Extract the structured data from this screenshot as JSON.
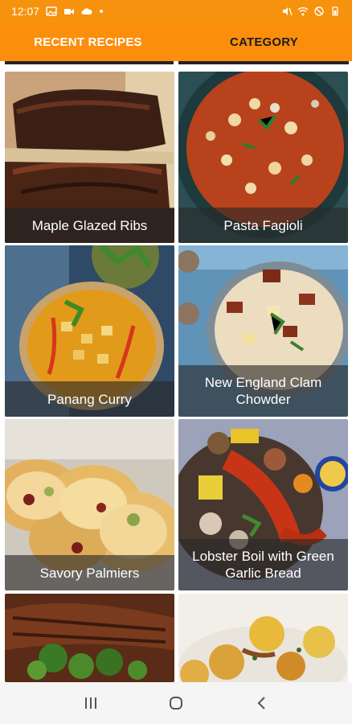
{
  "status_bar": {
    "time": "12:07",
    "left_icons": [
      "image-icon",
      "video-call-icon",
      "cloud-icon",
      "dot-icon"
    ],
    "right_icons": [
      "mute-icon",
      "wifi-icon",
      "do-not-disturb-icon",
      "battery-icon"
    ]
  },
  "tabs": [
    {
      "label": "RECENT RECIPES",
      "active": true
    },
    {
      "label": "CATEGORY",
      "active": false
    }
  ],
  "recipes": [
    {
      "name": "Maple Glazed Ribs"
    },
    {
      "name": "Pasta Fagioli"
    },
    {
      "name": "Panang Curry"
    },
    {
      "name": "New England Clam Chowder"
    },
    {
      "name": "Savory Palmiers"
    },
    {
      "name": "Lobster Boil with Green Garlic Bread"
    },
    {
      "name": ""
    },
    {
      "name": ""
    }
  ],
  "nav_bar": {
    "buttons": [
      "recent-apps-icon",
      "home-icon",
      "back-icon"
    ]
  },
  "colors": {
    "accent": "#fb8e0b",
    "status_bar": "#f6920d",
    "caption_overlay": "#282828"
  }
}
